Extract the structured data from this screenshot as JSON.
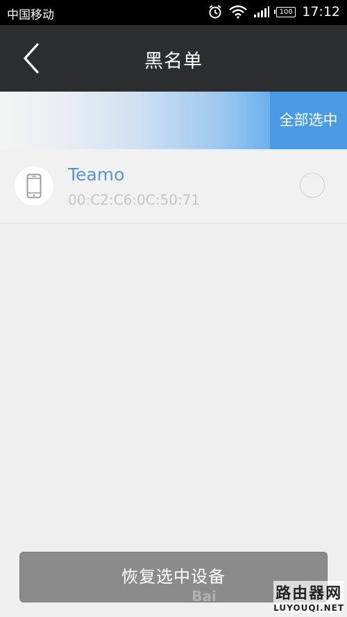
{
  "status_bar": {
    "carrier": "中国移动",
    "battery": "100",
    "time": "17:12"
  },
  "header": {
    "title": "黑名单",
    "back_icon": "chevron-left-icon"
  },
  "selection": {
    "select_all_label": "全部选中"
  },
  "devices": [
    {
      "name": "Teamo",
      "mac": "00:C2:C6:0C:50:71",
      "icon": "phone-icon",
      "selected": false
    }
  ],
  "footer": {
    "restore_label": "恢复选中设备"
  },
  "watermark": {
    "baidu": "Bai",
    "site_cn": "路由器网",
    "site_en": "LUYOUQI.NET"
  }
}
